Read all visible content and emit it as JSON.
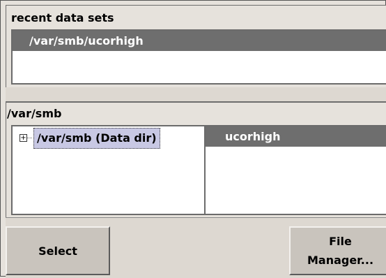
{
  "recent": {
    "title": "recent data sets",
    "items": [
      "/var/smb/ucorhigh"
    ]
  },
  "directory": {
    "path": "/var/smb",
    "tree": {
      "expander": "+",
      "node_label": "/var/smb (Data dir)"
    },
    "files": [
      "ucorhigh"
    ]
  },
  "buttons": {
    "select": "Select",
    "file_manager_line1": "File",
    "file_manager_line2": "Manager..."
  }
}
